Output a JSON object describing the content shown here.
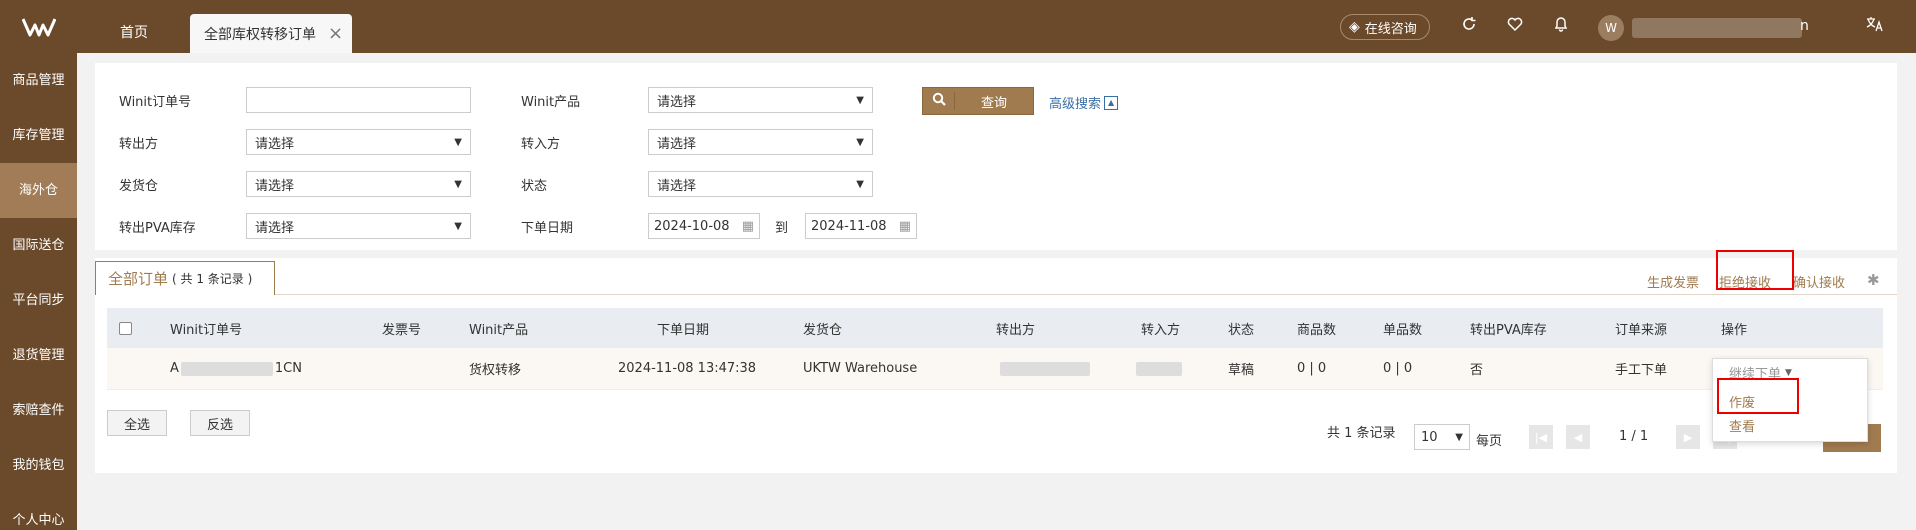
{
  "header": {
    "logo_icon": "w-logo-icon",
    "tabs": [
      {
        "label": "首页"
      },
      {
        "label": "全部库权转移订单"
      }
    ],
    "close_glyph": "×",
    "consult_label": "在线咨询",
    "user_suffix": "n"
  },
  "sidebar": {
    "items": [
      {
        "label": "商品管理"
      },
      {
        "label": "库存管理"
      },
      {
        "label": "海外仓"
      },
      {
        "label": "国际送仓"
      },
      {
        "label": "平台同步"
      },
      {
        "label": "退货管理"
      },
      {
        "label": "索赔查件"
      },
      {
        "label": "我的钱包"
      },
      {
        "label": "个人中心"
      }
    ]
  },
  "filter": {
    "order_no_label": "Winit订单号",
    "product_label": "Winit产品",
    "from_label": "转出方",
    "to_label": "转入方",
    "warehouse_label": "发货仓",
    "status_label": "状态",
    "pva_label": "转出PVA库存",
    "date_label": "下单日期",
    "select_placeholder": "请选择",
    "date_from": "2024-10-08",
    "date_to": "2024-11-08",
    "date_sep": "到",
    "query_label": "查询",
    "advanced_label": "高级搜索"
  },
  "list": {
    "tab_label": "全部订单",
    "count_text": "( 共 1 条记录 )",
    "actions": {
      "invoice": "生成发票",
      "reject": "拒绝接收",
      "confirm": "确认接收"
    },
    "columns": [
      "Winit订单号",
      "发票号",
      "Winit产品",
      "下单日期",
      "发货仓",
      "转出方",
      "转入方",
      "状态",
      "商品数",
      "单品数",
      "转出PVA库存",
      "订单来源",
      "操作"
    ],
    "rows": [
      {
        "order_no_prefix": "A",
        "order_no_suffix": "1CN",
        "invoice": "",
        "product": "货权转移",
        "date": "2024-11-08 13:47:38",
        "warehouse": "UKTW Warehouse",
        "status": "草稿",
        "goods": "0 | 0",
        "items": "0 | 0",
        "pva": "否",
        "source": "手工下单"
      }
    ],
    "dropdown": {
      "head": "继续下单",
      "items": [
        "作废",
        "查看"
      ]
    },
    "select_all": "全选",
    "invert": "反选"
  },
  "pager": {
    "total_text": "共 1 条记录",
    "page_size": "10",
    "per_page": "每页",
    "page_info": "1 / 1"
  },
  "colors": {
    "brand": "#6b4a2b",
    "accent": "#a07b50",
    "highlight": "#e00000"
  }
}
